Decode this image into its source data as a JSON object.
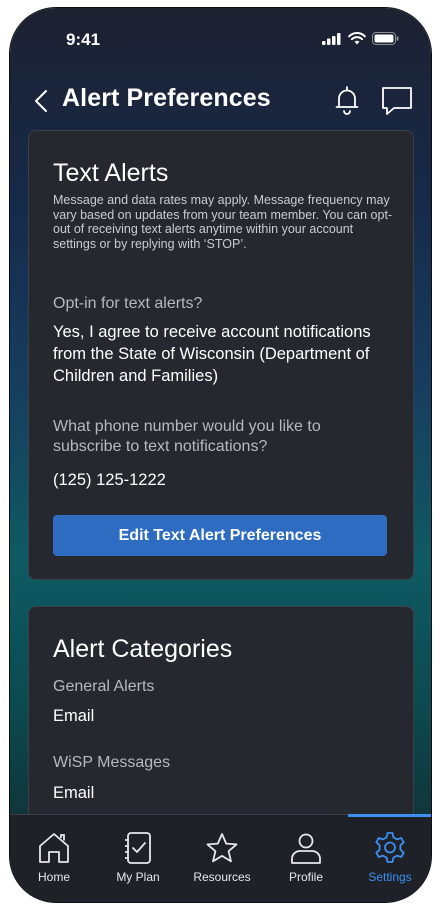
{
  "status_bar": {
    "time": "9:41"
  },
  "header": {
    "title": "Alert Preferences"
  },
  "text_alerts": {
    "heading": "Text Alerts",
    "disclaimer": "Message and data rates may apply. Message frequency may vary based on updates from your team member. You can opt-out of receiving text alerts anytime within your account settings or by replying with ‘STOP’.",
    "opt_in_label": "Opt-in for text alerts?",
    "opt_in_value": "Yes, I agree to receive account notifications from the State of Wisconsin (Department of Children and Families)",
    "phone_label": "What phone number would you like to subscribe to text notifications?",
    "phone_value": "(125) 125-1222",
    "edit_button": "Edit Text Alert Preferences"
  },
  "alert_categories": {
    "heading": "Alert Categories",
    "items": [
      {
        "label": "General Alerts",
        "value": "Email"
      },
      {
        "label": "WiSP Messages",
        "value": "Email"
      }
    ]
  },
  "tabbar": {
    "active": "Settings",
    "items": [
      {
        "label": "Home",
        "icon": "home-icon"
      },
      {
        "label": "My Plan",
        "icon": "checklist-icon"
      },
      {
        "label": "Resources",
        "icon": "star-icon"
      },
      {
        "label": "Profile",
        "icon": "person-icon"
      },
      {
        "label": "Settings",
        "icon": "gear-icon"
      }
    ]
  },
  "colors": {
    "accent": "#3d8ff0",
    "button": "#2d6cc0",
    "card": "#25282f"
  }
}
